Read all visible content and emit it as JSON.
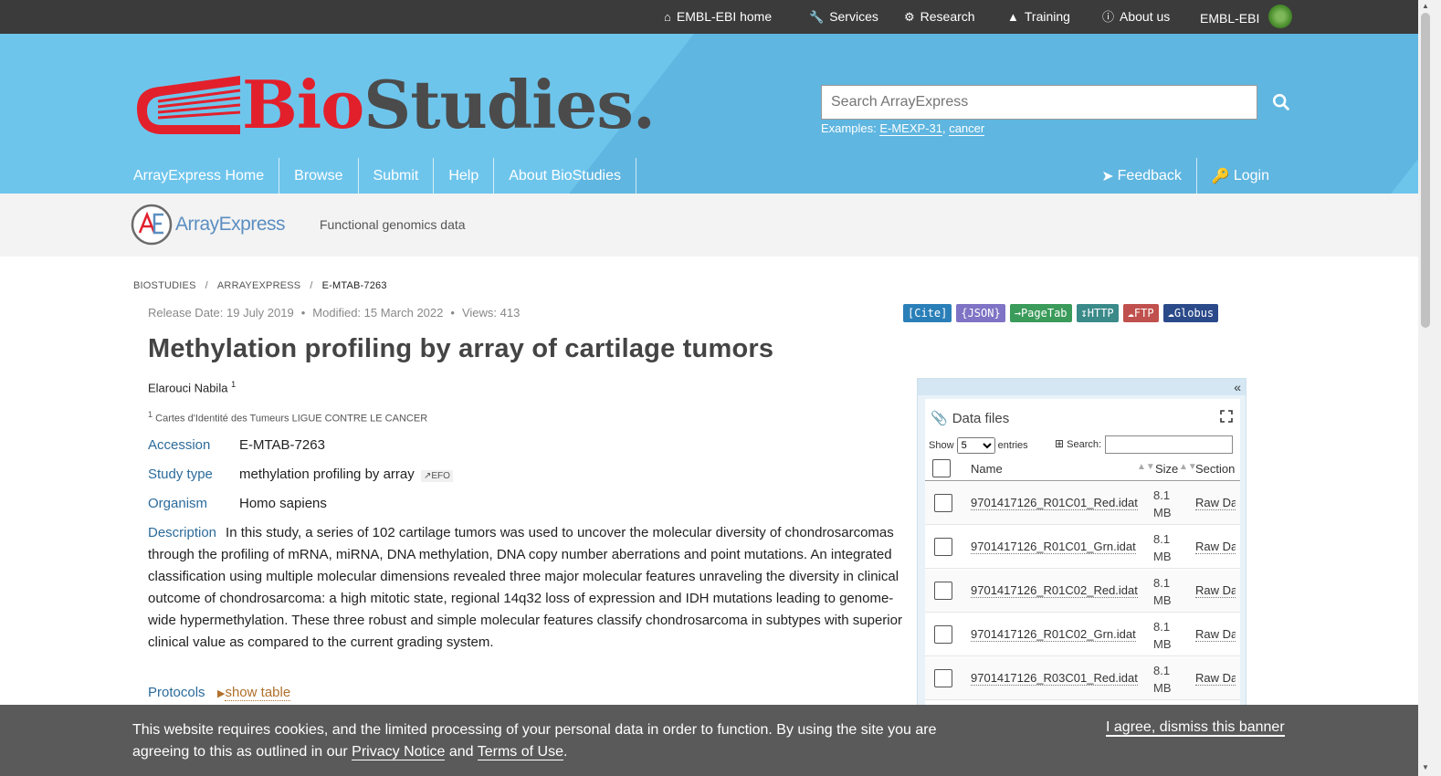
{
  "ebi_bar": {
    "items": [
      {
        "label": "EMBL-EBI home",
        "icon": "home-icon"
      },
      {
        "label": "Services",
        "icon": "wrench-icon"
      },
      {
        "label": "Research",
        "icon": "research-icon"
      },
      {
        "label": "Training",
        "icon": "training-icon"
      },
      {
        "label": "About us",
        "icon": "info-icon"
      }
    ],
    "brand": "EMBL-EBI"
  },
  "masthead": {
    "logo_bio": "Bio",
    "logo_studies": "Studies.",
    "search_placeholder": "Search ArrayExpress",
    "examples_label": "Examples:",
    "example_1": "E-MEXP-31",
    "example_2": "cancer",
    "nav": [
      "ArrayExpress Home",
      "Browse",
      "Submit",
      "Help",
      "About BioStudies"
    ],
    "feedback": "Feedback",
    "login": "Login"
  },
  "subbrand": {
    "name": "ArrayExpress",
    "tagline": "Functional genomics data"
  },
  "breadcrumb": [
    "BIOSTUDIES",
    "ARRAYEXPRESS",
    "E-MTAB-7263"
  ],
  "meta": {
    "release": "Release Date: 19 July 2019",
    "modified": "Modified: 15 March 2022",
    "views": "Views: 413"
  },
  "buttons": [
    {
      "label": "[Cite]",
      "color": "#2a7fb8"
    },
    {
      "label": "{JSON}",
      "color": "#7e73c4"
    },
    {
      "label": "→PageTab",
      "color": "#3a9b5a"
    },
    {
      "label": "HTTP",
      "color": "#3b8a8a"
    },
    {
      "label": "FTP",
      "color": "#c0504d"
    },
    {
      "label": "Globus",
      "color": "#2b4a8a"
    }
  ],
  "study": {
    "title": "Methylation profiling by array of cartilage tumors",
    "author": "Elarouci Nabila",
    "author_sup": "1",
    "affiliation": "Cartes d'Identité des Tumeurs LIGUE CONTRE LE CANCER",
    "affiliation_sup": "1",
    "accession_label": "Accession",
    "accession": "E-MTAB-7263",
    "study_type_label": "Study type",
    "study_type": "methylation profiling by array",
    "efo": "EFO",
    "organism_label": "Organism",
    "organism": "Homo sapiens",
    "description_label": "Description",
    "description": "In this study, a series of 102 cartilage tumors was used to uncover the molecular diversity of chondrosarcomas through the profiling of mRNA, miRNA, DNA methylation, DNA copy number aberrations and point mutations. An integrated classification using multiple molecular dimensions revealed three major molecular features unraveling the diversity in clinical outcome of chondrosarcoma: a high mitotic state, regional 14q32 loss of expression and IDH mutations leading to genome-wide hypermethylation. These three robust and simple molecular features classify chondrosarcoma in subtypes with superior clinical value as compared to the current grading system.",
    "protocols_label": "Protocols",
    "show_table": "show table"
  },
  "data_files": {
    "title": "Data files",
    "show": "Show",
    "entries_value": "5",
    "entries": "entries",
    "search": "Search:",
    "columns": [
      "Name",
      "Size",
      "Section"
    ],
    "rows": [
      {
        "name": "9701417126_R01C01_Red.idat",
        "size": "8.1 MB",
        "section": "Raw Data"
      },
      {
        "name": "9701417126_R01C01_Grn.idat",
        "size": "8.1 MB",
        "section": "Raw Data"
      },
      {
        "name": "9701417126_R01C02_Red.idat",
        "size": "8.1 MB",
        "section": "Raw Data"
      },
      {
        "name": "9701417126_R01C02_Grn.idat",
        "size": "8.1 MB",
        "section": "Raw Data"
      },
      {
        "name": "9701417126_R03C01_Red.idat",
        "size": "8.1 MB",
        "section": "Raw Data"
      }
    ]
  },
  "cookie": {
    "text_1": "This website requires cookies, and the limited processing of your personal data in order to function. By using the site you are agreeing to this as outlined in our",
    "privacy": "Privacy Notice",
    "and": "and",
    "terms": "Terms of Use",
    "agree": "I agree, dismiss this banner"
  }
}
